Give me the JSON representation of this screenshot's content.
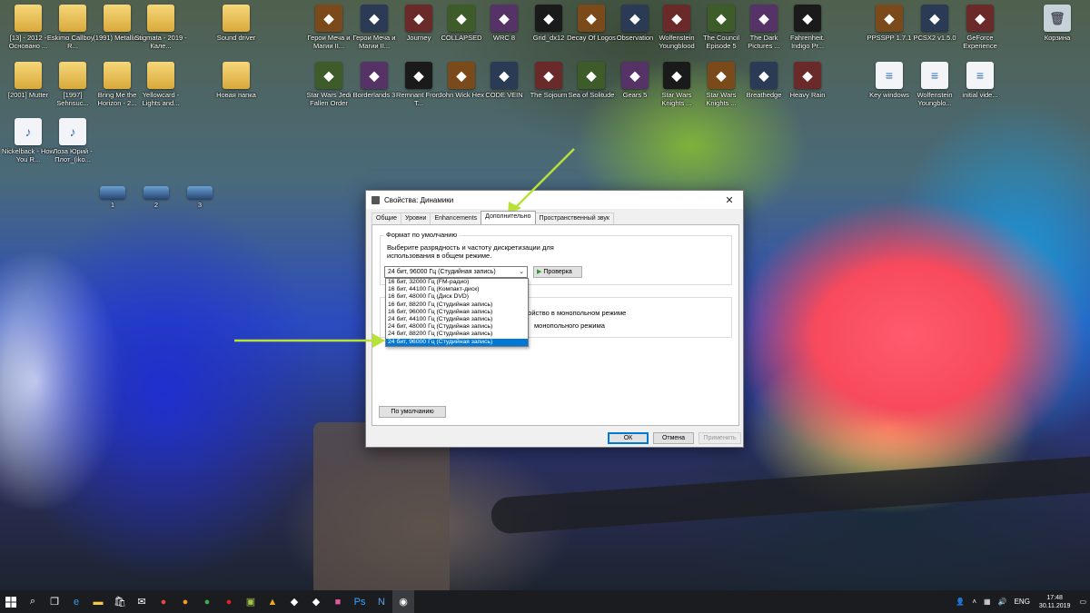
{
  "desktop": {
    "icons": [
      {
        "label": "[13] - 2012 - Основано ...",
        "icon": "folder-icon"
      },
      {
        "label": "Eskimo Callboy - R...",
        "icon": "folder-icon"
      },
      {
        "label": "(1991) Metallica",
        "icon": "folder-icon"
      },
      {
        "label": "Stigmata - 2019 - Кале...",
        "icon": "folder-icon"
      },
      {
        "label": "Sound driver",
        "icon": "folder-icon"
      },
      {
        "label": "Герои Меча и Магии II...",
        "icon": "game-icon"
      },
      {
        "label": "Герои Меча и Магии II...",
        "icon": "game-icon"
      },
      {
        "label": "Journey",
        "icon": "game-icon"
      },
      {
        "label": "COLLAPSED",
        "icon": "game-icon"
      },
      {
        "label": "WRC 8",
        "icon": "game-icon"
      },
      {
        "label": "Grid_dx12",
        "icon": "game-icon"
      },
      {
        "label": "Decay Of Logos",
        "icon": "game-icon"
      },
      {
        "label": "Observation",
        "icon": "game-icon"
      },
      {
        "label": "Wolfenstein Youngblood",
        "icon": "game-icon"
      },
      {
        "label": "The Council Episode 5",
        "icon": "game-icon"
      },
      {
        "label": "The Dark Pictures ...",
        "icon": "game-icon"
      },
      {
        "label": "Fahrenheit. Indigo Pr...",
        "icon": "game-icon"
      },
      {
        "label": "PPSSPP 1.7.1",
        "icon": "game-icon"
      },
      {
        "label": "PCSX2 v1.5.0",
        "icon": "game-icon"
      },
      {
        "label": "GeForce Experience",
        "icon": "game-icon"
      },
      {
        "label": "Корзина",
        "icon": "recycle-bin-icon"
      },
      {
        "label": "[2001] Mutter",
        "icon": "folder-icon"
      },
      {
        "label": "[1997] Sehnsuc...",
        "icon": "folder-icon"
      },
      {
        "label": "Bring Me the Horizon - 2...",
        "icon": "folder-icon"
      },
      {
        "label": "Yellowcard - Lights and...",
        "icon": "folder-icon"
      },
      {
        "label": "Новая папка",
        "icon": "folder-icon"
      },
      {
        "label": "Star Wars Jedi Fallen Order",
        "icon": "game-icon"
      },
      {
        "label": "Borderlands 3",
        "icon": "game-icon"
      },
      {
        "label": "Remnant From T...",
        "icon": "game-icon"
      },
      {
        "label": "John Wick Hex",
        "icon": "game-icon"
      },
      {
        "label": "CODE VEIN",
        "icon": "game-icon"
      },
      {
        "label": "The Sojourn",
        "icon": "game-icon"
      },
      {
        "label": "Sea of Solitude",
        "icon": "game-icon"
      },
      {
        "label": "Gears 5",
        "icon": "game-icon"
      },
      {
        "label": "Star Wars Knights ...",
        "icon": "game-icon"
      },
      {
        "label": "Star Wars Knights ...",
        "icon": "game-icon"
      },
      {
        "label": "Breathedge",
        "icon": "game-icon"
      },
      {
        "label": "Heavy Rain",
        "icon": "game-icon"
      },
      {
        "label": "Key windows",
        "icon": "document-icon"
      },
      {
        "label": "Wolfenstein Youngblo...",
        "icon": "document-icon"
      },
      {
        "label": "initial vide...",
        "icon": "document-icon"
      },
      {
        "label": "Nickelback - How You R...",
        "icon": "audio-icon"
      },
      {
        "label": "Лоза Юрий - Плот_(iko...",
        "icon": "audio-icon"
      },
      {
        "label": "1",
        "icon": "image-icon"
      },
      {
        "label": "2",
        "icon": "image-icon"
      },
      {
        "label": "3",
        "icon": "image-icon"
      }
    ]
  },
  "dialog": {
    "title": "Свойства: Динамики",
    "close": "✕",
    "tabs": [
      "Общие",
      "Уровни",
      "Enhancements",
      "Дополнительно",
      "Пространственный звук"
    ],
    "group_title": "Формат по умолчанию",
    "group_desc": "Выберите разрядность и частоту дискретизации для использования в общем режиме.",
    "select_value": "24 бит, 96000 Гц (Студийная запись)",
    "test_button": "Проверка",
    "options": [
      "16 бит, 32000 Гц (FM-радио)",
      "16 бит, 44100 Гц (Компакт-диск)",
      "16 бит, 48000 Гц (Диск DVD)",
      "16 бит, 88200 Гц (Студийная запись)",
      "16 бит, 96000 Гц (Студийная запись)",
      "24 бит, 44100 Гц (Студийная запись)",
      "24 бит, 48000 Гц (Студийная запись)",
      "24 бит, 88200 Гц (Студийная запись)",
      "24 бит, 96000 Гц (Студийная запись)"
    ],
    "exclusive_1": "ройство в монопольном режиме",
    "exclusive_2": "монопольного режима",
    "default_button": "По умолчанию",
    "ok": "ОК",
    "cancel": "Отмена",
    "apply": "Применить"
  },
  "taskbar": {
    "lang": "ENG",
    "time": "17:48",
    "date": "30.11.2019"
  },
  "colors": {
    "arrow": "#b8e23a",
    "selection": "#0078d7"
  }
}
